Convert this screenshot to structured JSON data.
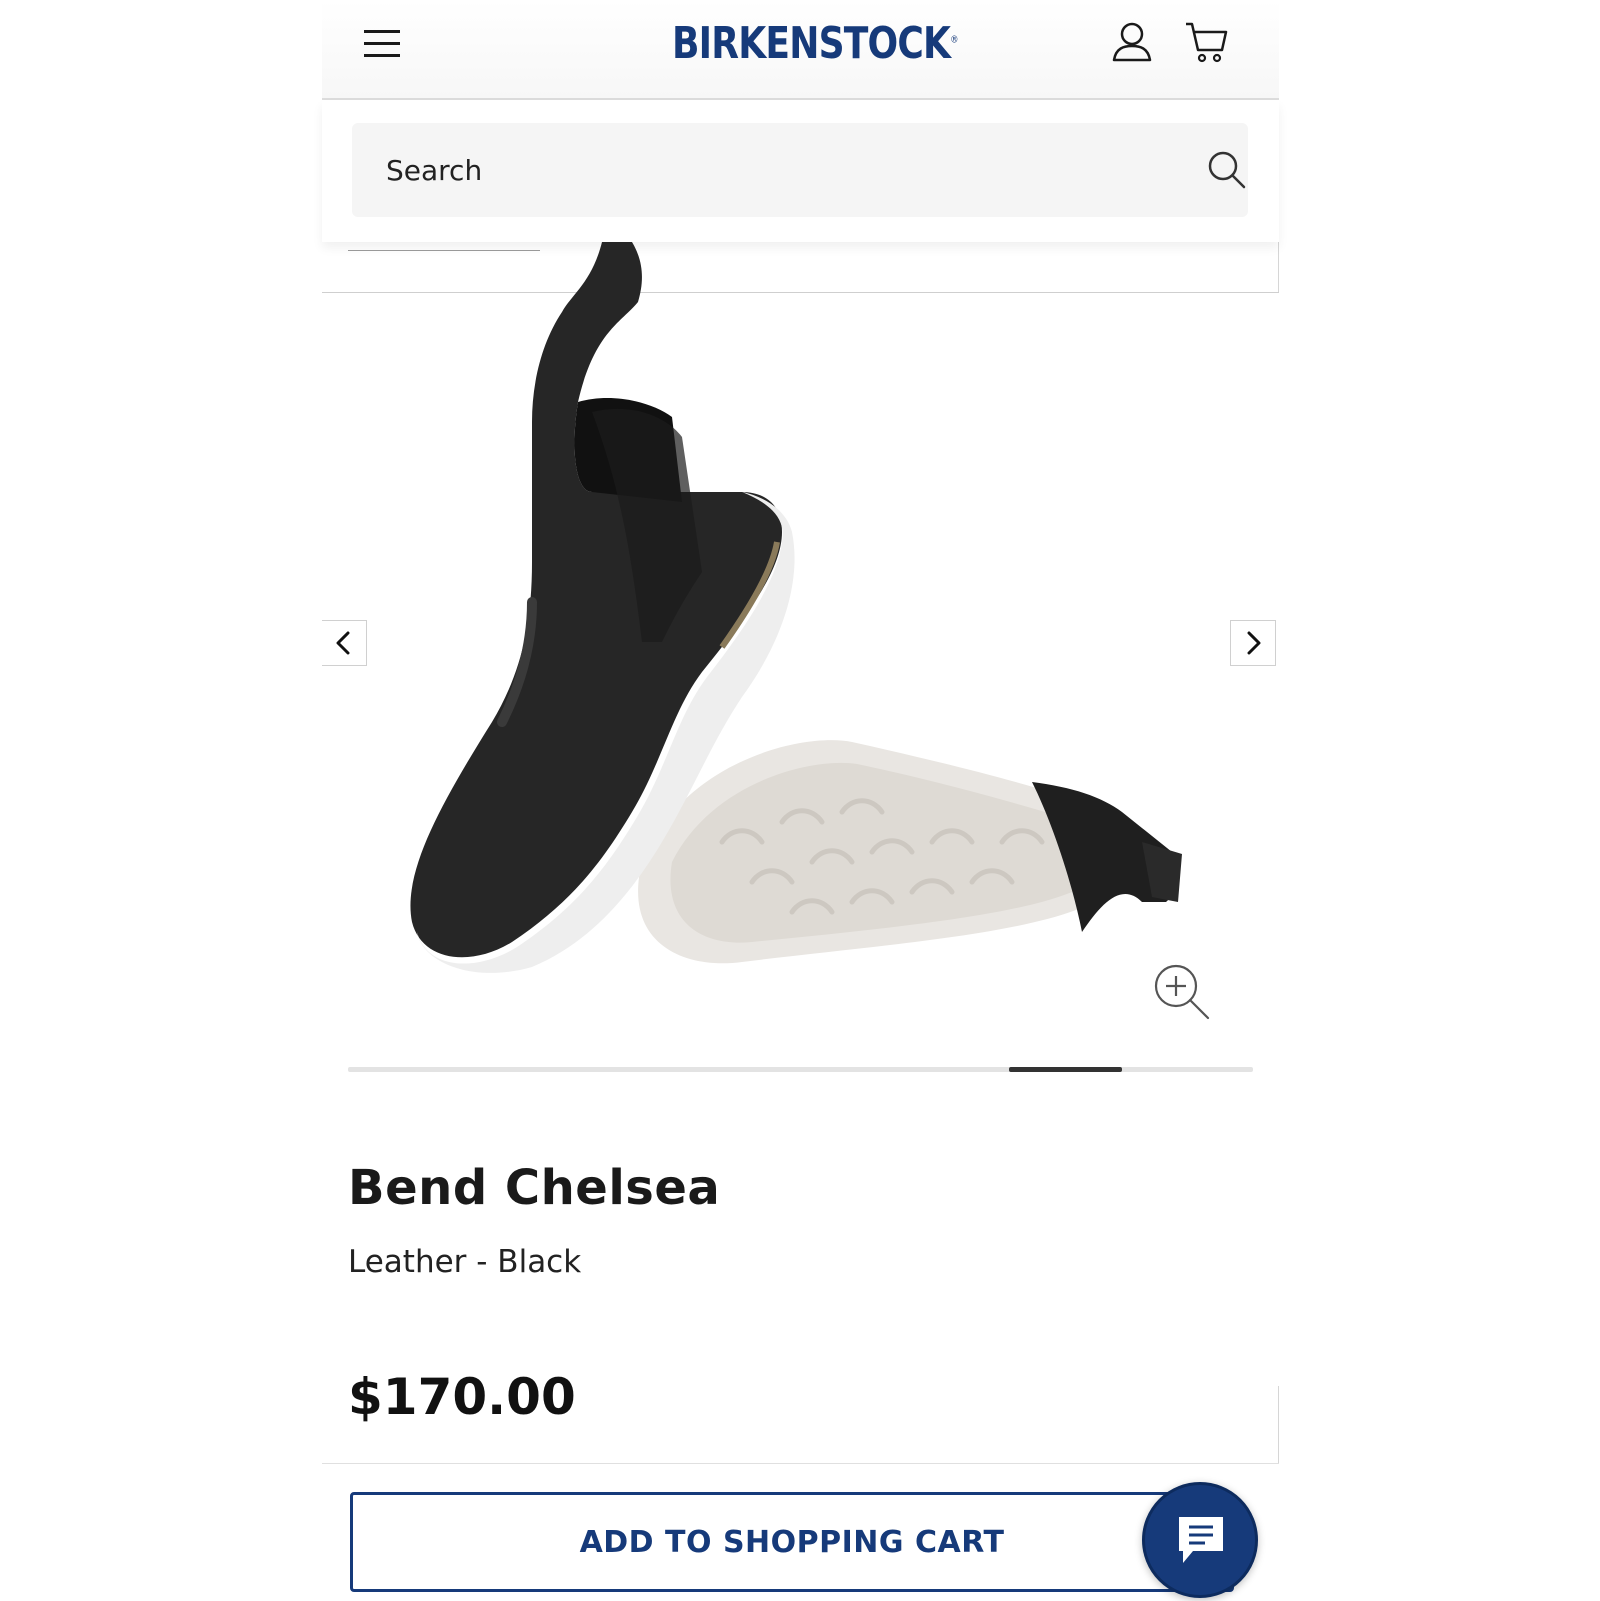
{
  "header": {
    "brand": "BIRKENSTOCK",
    "brand_mark": "®",
    "icons": [
      "menu-icon",
      "account-icon",
      "cart-icon"
    ]
  },
  "search": {
    "placeholder": "Search",
    "icon": "search-icon"
  },
  "gallery": {
    "image_alt": "Bend Chelsea boot",
    "prev_icon": "chevron-left-icon",
    "next_icon": "chevron-right-icon",
    "zoom_icon": "zoom-in-icon"
  },
  "product": {
    "title": "Bend Chelsea",
    "variant": "Leather - Black",
    "price": "$170.00"
  },
  "actions": {
    "add_to_cart_label": "ADD TO SHOPPING CART",
    "chat_icon": "chat-icon"
  },
  "colors": {
    "brand_blue": "#163a7a",
    "text_dark": "#1a1a1a",
    "search_bg": "#f5f5f5"
  }
}
